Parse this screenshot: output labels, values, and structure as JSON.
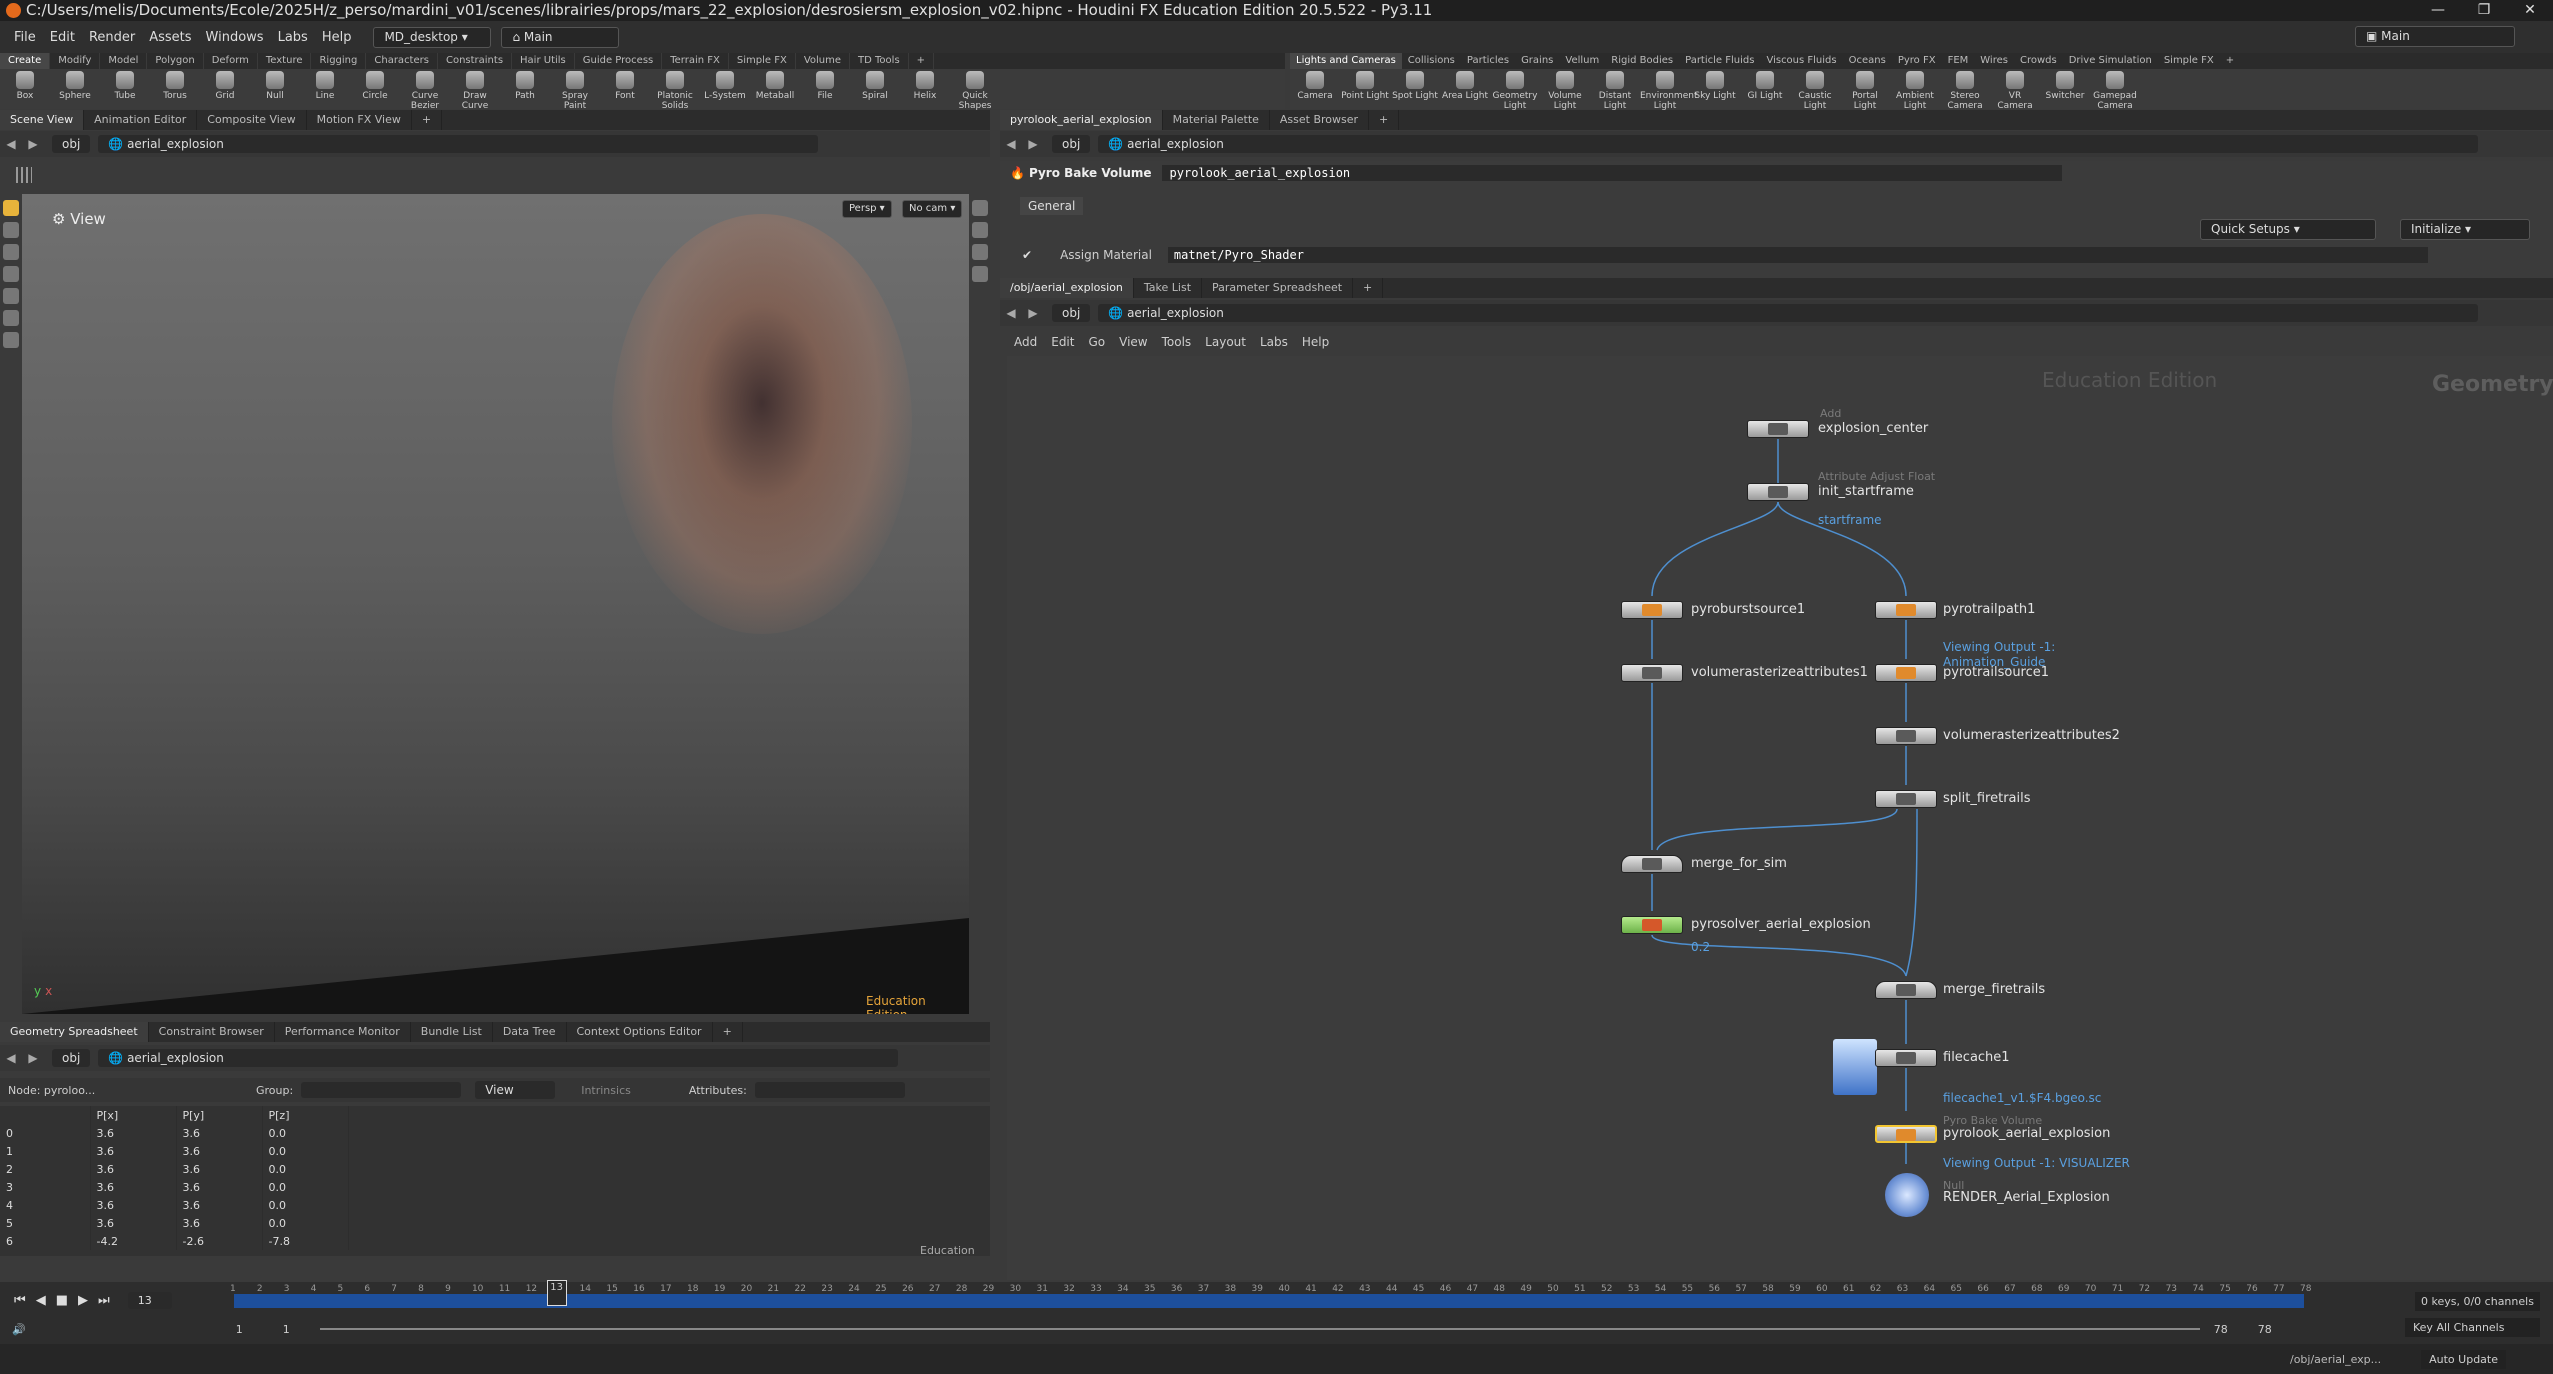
{
  "titlebar": {
    "path": "C:/Users/melis/Documents/Ecole/2025H/z_perso/mardini_v01/scenes/librairies/props/mars_22_explosion/desrosiersm_explosion_v02.hipnc - Houdini FX Education Edition 20.5.522 - Py3.11",
    "min": "—",
    "max": "❐",
    "close": "✕"
  },
  "menubar": {
    "items": [
      "File",
      "Edit",
      "Render",
      "Assets",
      "Windows",
      "Labs",
      "Help"
    ],
    "desktop": "MD_desktop",
    "context": "Main",
    "right_context": "Main"
  },
  "shelf_left_tabs": [
    "Create",
    "Modify",
    "Model",
    "Polygon",
    "Deform",
    "Texture",
    "Rigging",
    "Characters",
    "Constraints",
    "Hair Utils",
    "Guide Process",
    "Terrain FX",
    "Simple FX",
    "Volume",
    "TD Tools",
    "+"
  ],
  "shelf_left_tools": [
    "Box",
    "Sphere",
    "Tube",
    "Torus",
    "Grid",
    "Null",
    "Line",
    "Circle",
    "Curve Bezier",
    "Draw Curve",
    "Path",
    "Spray Paint",
    "Font",
    "Platonic Solids",
    "L-System",
    "Metaball",
    "File",
    "Spiral",
    "Helix",
    "Quick Shapes"
  ],
  "shelf_right_tabs": [
    "Lights and Cameras",
    "Collisions",
    "Particles",
    "Grains",
    "Vellum",
    "Rigid Bodies",
    "Particle Fluids",
    "Viscous Fluids",
    "Oceans",
    "Pyro FX",
    "FEM",
    "Wires",
    "Crowds",
    "Drive Simulation",
    "Simple FX",
    "+"
  ],
  "shelf_right_tools": [
    "Camera",
    "Point Light",
    "Spot Light",
    "Area Light",
    "Geometry Light",
    "Volume Light",
    "Distant Light",
    "Environment Light",
    "Sky Light",
    "GI Light",
    "Caustic Light",
    "Portal Light",
    "Ambient Light",
    "Stereo Camera",
    "VR Camera",
    "Switcher",
    "Gamepad Camera"
  ],
  "viewer": {
    "tabs": [
      "Scene View",
      "Animation Editor",
      "Composite View",
      "Motion FX View",
      "+"
    ],
    "obj": "obj",
    "path": "aerial_explosion",
    "view_label": "View",
    "persp": "Persp ▾",
    "cam": "No cam ▾",
    "edition": "Education Edition",
    "axis_y": "y",
    "axis_x": "x"
  },
  "params": {
    "tabs": [
      "pyrolook_aerial_explosion",
      "Material Palette",
      "Asset Browser",
      "+"
    ],
    "obj": "obj",
    "path": "aerial_explosion",
    "node_type": "Pyro Bake Volume",
    "node_name": "pyrolook_aerial_explosion",
    "tab_general": "General",
    "quick_setups": "Quick Setups",
    "initialize": "Initialize",
    "assign_label": "Assign Material",
    "assign_value": "matnet/Pyro_Shader"
  },
  "network": {
    "tabs": [
      "/obj/aerial_explosion",
      "Take List",
      "Parameter Spreadsheet",
      "+"
    ],
    "obj": "obj",
    "path": "aerial_explosion",
    "menu": [
      "Add",
      "Edit",
      "Go",
      "View",
      "Tools",
      "Layout",
      "Labs",
      "Help"
    ],
    "watermark": "Education Edition",
    "context_label": "Geometry",
    "nodes": {
      "explosion_center": {
        "type": "Add",
        "name": "explosion_center"
      },
      "init_startframe": {
        "type": "Attribute Adjust Float",
        "name": "init_startframe",
        "note": "startframe"
      },
      "pyroburstsource1": {
        "name": "pyroburstsource1"
      },
      "pyrotrailpath1": {
        "name": "pyrotrailpath1",
        "note1": "Viewing Output -1:",
        "note2": "Animation_Guide"
      },
      "volumerasterizeattributes1": {
        "name": "volumerasterizeattributes1"
      },
      "pyrotrailsource1": {
        "name": "pyrotrailsource1"
      },
      "volumerasterizeattributes2": {
        "name": "volumerasterizeattributes2"
      },
      "split_firetrails": {
        "name": "split_firetrails"
      },
      "merge_for_sim": {
        "name": "merge_for_sim"
      },
      "pyrosolver": {
        "name": "pyrosolver_aerial_explosion",
        "note": "0.2"
      },
      "merge_firetrails": {
        "name": "merge_firetrails"
      },
      "filecache1": {
        "name": "filecache1",
        "note": "filecache1_v1.$F4.bgeo.sc"
      },
      "pyrolook": {
        "type": "Pyro Bake Volume",
        "name": "pyrolook_aerial_explosion",
        "note": "Viewing Output -1: VISUALIZER"
      },
      "render": {
        "type": "Null",
        "name": "RENDER_Aerial_Explosion"
      }
    }
  },
  "spreadsheet": {
    "tabs": [
      "Geometry Spreadsheet",
      "Constraint Browser",
      "Performance Monitor",
      "Bundle List",
      "Data Tree",
      "Context Options Editor",
      "+"
    ],
    "obj": "obj",
    "path": "aerial_explosion",
    "node_label": "Node: pyroloo...",
    "group_label": "Group:",
    "view": "View",
    "intrinsics": "Intrinsics",
    "attributes": "Attributes:",
    "edition": "Education",
    "columns": [
      "",
      "P[x]",
      "P[y]",
      "P[z]"
    ],
    "rows": [
      [
        "0",
        "3.6",
        "3.6",
        "0.0"
      ],
      [
        "1",
        "3.6",
        "3.6",
        "0.0"
      ],
      [
        "2",
        "3.6",
        "3.6",
        "0.0"
      ],
      [
        "3",
        "3.6",
        "3.6",
        "0.0"
      ],
      [
        "4",
        "3.6",
        "3.6",
        "0.0"
      ],
      [
        "5",
        "3.6",
        "3.6",
        "0.0"
      ],
      [
        "6",
        "-4.2",
        "-2.6",
        "-7.8"
      ]
    ]
  },
  "timeline": {
    "current_frame": "13",
    "start": "1",
    "start2": "1",
    "end": "78",
    "end2": "78",
    "keys": "0 keys, 0/0 channels",
    "key_all": "Key All Channels",
    "auto_update": "Auto Update",
    "obj_path": "/obj/aerial_exp...",
    "frame_range": [
      1,
      78
    ],
    "current": 13
  }
}
